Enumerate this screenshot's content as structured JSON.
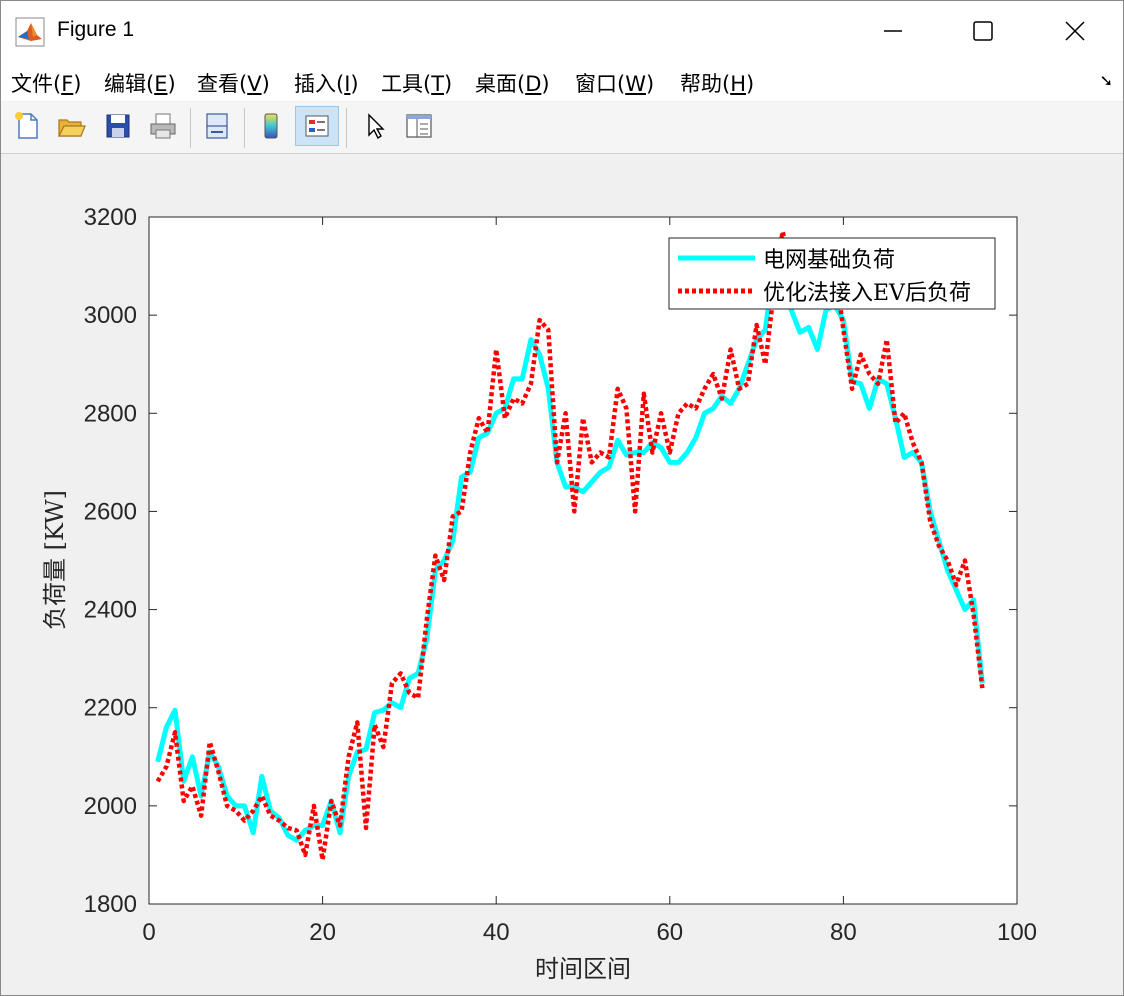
{
  "window": {
    "title": "Figure 1"
  },
  "menu": {
    "items": [
      {
        "pre": "文件(",
        "key": "F",
        "post": ")"
      },
      {
        "pre": "编辑(",
        "key": "E",
        "post": ")"
      },
      {
        "pre": "查看(",
        "key": "V",
        "post": ")"
      },
      {
        "pre": "插入(",
        "key": "I",
        "post": ")"
      },
      {
        "pre": "工具(",
        "key": "T",
        "post": ")"
      },
      {
        "pre": "桌面(",
        "key": "D",
        "post": ")"
      },
      {
        "pre": "窗口(",
        "key": "W",
        "post": ")"
      },
      {
        "pre": "帮助(",
        "key": "H",
        "post": ")"
      }
    ]
  },
  "toolbar": {
    "icons": [
      "new-figure-icon",
      "open-file-icon",
      "save-icon",
      "print-icon",
      "link-plot-icon",
      "colorbar-icon",
      "legend-icon",
      "edit-plot-icon",
      "property-inspector-icon"
    ]
  },
  "colors": {
    "base_series": "#00ffff",
    "ev_series": "#ff0000"
  },
  "chart_data": {
    "type": "line",
    "xlabel": "时间区间",
    "ylabel": "负荷量 [KW]",
    "xlim": [
      0,
      100
    ],
    "ylim": [
      1800,
      3200
    ],
    "xticks": [
      0,
      20,
      40,
      60,
      80,
      100
    ],
    "yticks": [
      1800,
      2000,
      2200,
      2400,
      2600,
      2800,
      3000,
      3200
    ],
    "legend_position": "top-right",
    "series": [
      {
        "name": "电网基础负荷",
        "style": "solid",
        "x": [
          1,
          2,
          3,
          4,
          5,
          6,
          7,
          8,
          9,
          10,
          11,
          12,
          13,
          14,
          15,
          16,
          17,
          18,
          19,
          20,
          21,
          22,
          23,
          24,
          25,
          26,
          27,
          28,
          29,
          30,
          31,
          32,
          33,
          34,
          35,
          36,
          37,
          38,
          39,
          40,
          41,
          42,
          43,
          44,
          45,
          46,
          47,
          48,
          49,
          50,
          51,
          52,
          53,
          54,
          55,
          56,
          57,
          58,
          59,
          60,
          61,
          62,
          63,
          64,
          65,
          66,
          67,
          68,
          69,
          70,
          71,
          72,
          73,
          74,
          75,
          76,
          77,
          78,
          79,
          80,
          81,
          82,
          83,
          84,
          85,
          86,
          87,
          88,
          89,
          90,
          91,
          92,
          93,
          94,
          95,
          96
        ],
        "y": [
          2090,
          2160,
          2195,
          2050,
          2100,
          2020,
          2110,
          2080,
          2020,
          2000,
          2000,
          1945,
          2060,
          1990,
          1975,
          1940,
          1930,
          1950,
          1960,
          1960,
          2010,
          1945,
          2060,
          2110,
          2115,
          2190,
          2195,
          2210,
          2200,
          2260,
          2270,
          2340,
          2480,
          2500,
          2540,
          2670,
          2680,
          2750,
          2760,
          2800,
          2810,
          2870,
          2870,
          2950,
          2920,
          2850,
          2700,
          2650,
          2650,
          2640,
          2660,
          2680,
          2690,
          2745,
          2715,
          2720,
          2720,
          2740,
          2730,
          2700,
          2700,
          2720,
          2750,
          2800,
          2810,
          2835,
          2820,
          2850,
          2900,
          2950,
          2970,
          3100,
          3100,
          3010,
          2965,
          2975,
          2930,
          3010,
          3020,
          2990,
          2865,
          2860,
          2810,
          2870,
          2860,
          2790,
          2710,
          2720,
          2700,
          2600,
          2540,
          2480,
          2440,
          2400,
          2420,
          2250
        ]
      },
      {
        "name": "优化法接入EV后负荷",
        "style": "dotted",
        "x": [
          1,
          2,
          3,
          4,
          5,
          6,
          7,
          8,
          9,
          10,
          11,
          12,
          13,
          14,
          15,
          16,
          17,
          18,
          19,
          20,
          21,
          22,
          23,
          24,
          25,
          26,
          27,
          28,
          29,
          30,
          31,
          32,
          33,
          34,
          35,
          36,
          37,
          38,
          39,
          40,
          41,
          42,
          43,
          44,
          45,
          46,
          47,
          48,
          49,
          50,
          51,
          52,
          53,
          54,
          55,
          56,
          57,
          58,
          59,
          60,
          61,
          62,
          63,
          64,
          65,
          66,
          67,
          68,
          69,
          70,
          71,
          72,
          73,
          74,
          75,
          76,
          77,
          78,
          79,
          80,
          81,
          82,
          83,
          84,
          85,
          86,
          87,
          88,
          89,
          90,
          91,
          92,
          93,
          94,
          95,
          96
        ],
        "y": [
          2050,
          2080,
          2150,
          2010,
          2040,
          1980,
          2130,
          2070,
          2000,
          1990,
          1970,
          1990,
          2020,
          1980,
          1970,
          1955,
          1950,
          1900,
          2000,
          1890,
          2010,
          1960,
          2100,
          2170,
          1955,
          2165,
          2120,
          2250,
          2270,
          2230,
          2220,
          2380,
          2510,
          2460,
          2590,
          2600,
          2720,
          2790,
          2760,
          2930,
          2790,
          2830,
          2820,
          2860,
          2990,
          2970,
          2700,
          2800,
          2600,
          2790,
          2700,
          2720,
          2710,
          2850,
          2810,
          2600,
          2840,
          2720,
          2800,
          2720,
          2800,
          2820,
          2810,
          2850,
          2880,
          2830,
          2930,
          2850,
          2860,
          2980,
          2900,
          3050,
          3170,
          3100,
          3060,
          3040,
          3050,
          3080,
          3100,
          2970,
          2850,
          2920,
          2880,
          2860,
          2950,
          2780,
          2800,
          2740,
          2700,
          2580,
          2530,
          2500,
          2450,
          2500,
          2390,
          2240
        ]
      }
    ]
  }
}
